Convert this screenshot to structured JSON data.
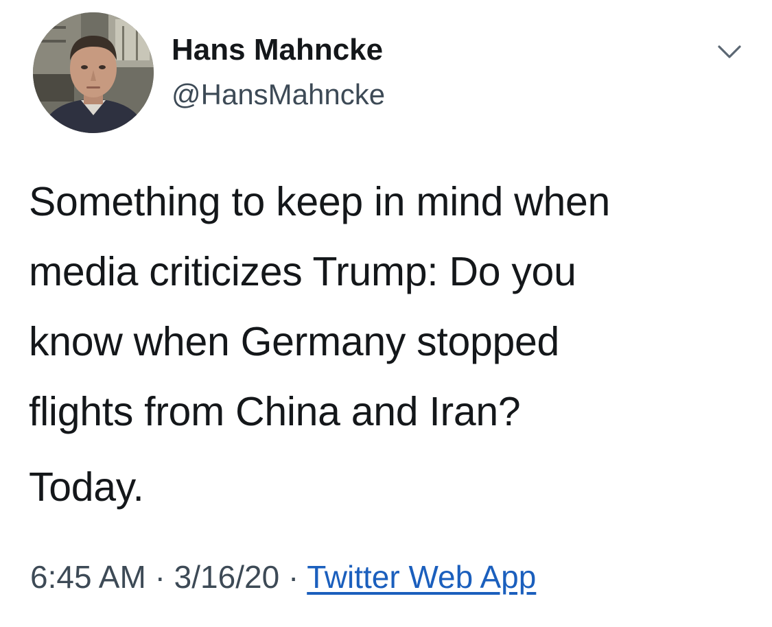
{
  "author": {
    "display_name": "Hans Mahncke",
    "handle": "@HansMahncke"
  },
  "menu": {
    "icon": "chevron-down-icon"
  },
  "tweet": {
    "lines": [
      "Something to keep in mind when",
      "media criticizes Trump: Do you",
      "know when Germany stopped",
      "flights from China and Iran?"
    ],
    "closing": "Today."
  },
  "meta": {
    "time": "6:45 AM",
    "separator": "·",
    "date": "3/16/20",
    "source": "Twitter Web App"
  },
  "colors": {
    "text": "#14171a",
    "secondary": "#3d4a56",
    "link": "#1b5fbd"
  }
}
